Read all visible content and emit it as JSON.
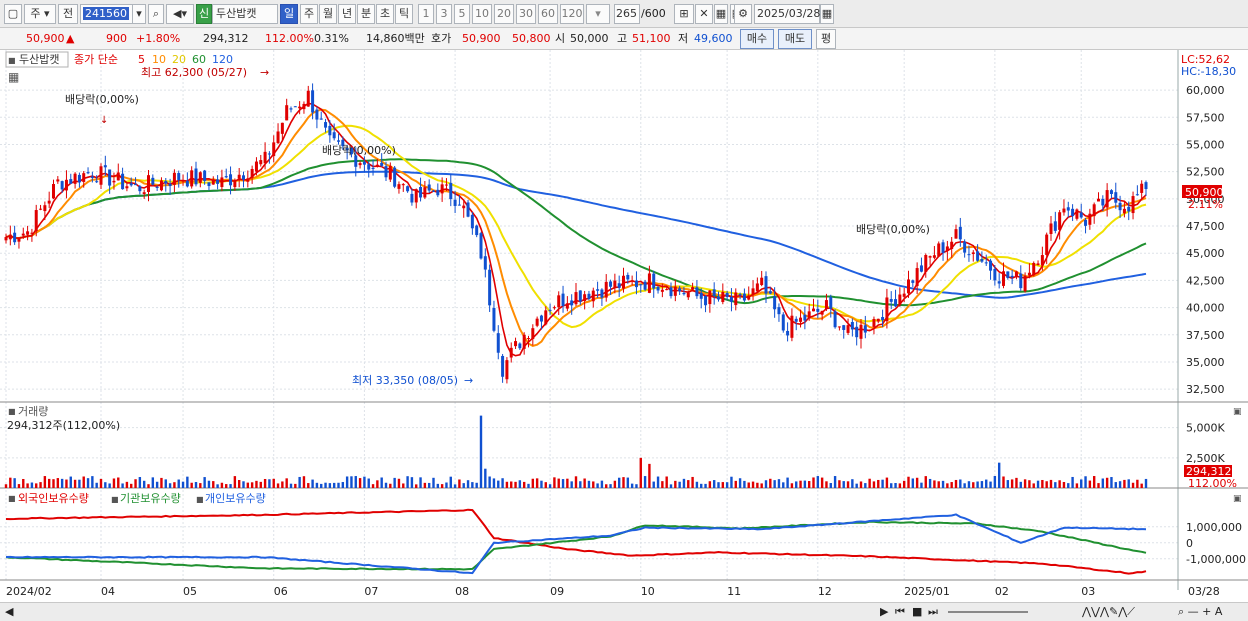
{
  "toolbar": {
    "market": "주",
    "type": "전",
    "code": "241560",
    "name": "두산밥캣",
    "period_sel": "일",
    "periods": [
      "주",
      "월",
      "년",
      "분",
      "초",
      "틱"
    ],
    "nums": [
      "1",
      "3",
      "5",
      "10",
      "20",
      "30",
      "60",
      "120"
    ],
    "count": "265",
    "count_total": "/600",
    "date": "2025/03/28"
  },
  "info": {
    "price": "50,900",
    "arrow": "▲",
    "change": "900",
    "pct": "+1.80%",
    "volume": "294,312",
    "vol_ratio": "112.00%",
    "turnover": "0.31%",
    "amount": "14,860백만",
    "hoga_label": "호가",
    "ask": "50,900",
    "bid": "50,800",
    "open_label": "시",
    "open": "50,000",
    "high_label": "고",
    "high": "51,100",
    "low_label": "저",
    "low": "49,600",
    "buy": "매수",
    "sell": "매도",
    "eval": "평"
  },
  "price_panel": {
    "title": "두산밥캣",
    "ma_label": "종가 단순",
    "ma_periods": [
      "5",
      "10",
      "20",
      "60",
      "120"
    ],
    "max_note": "최고 62,300 (05/27)",
    "min_note": "최저 33,350 (08/05)",
    "div_notes": [
      "배당락(0,00%)",
      "배당락(0,00%)",
      "배당락(0,00%)"
    ],
    "lc": "LC:52,62",
    "hc": "HC:-18,30",
    "cur_price": "50,900",
    "cur_pct": "2.11%",
    "yticks": [
      "60,000",
      "57,500",
      "55,000",
      "52,500",
      "50,000",
      "47,500",
      "45,000",
      "42,500",
      "40,000",
      "37,500",
      "35,000",
      "32,500"
    ]
  },
  "volume_panel": {
    "title": "거래량",
    "value": "294,312주(112,00%)",
    "yticks": [
      "5,000K",
      "2,500K"
    ],
    "cur": "294,312",
    "cur_pct": "112.00%"
  },
  "holding_panel": {
    "items": [
      "외국인보유수량",
      "기관보유수량",
      "개인보유수량"
    ],
    "yticks": [
      "1,000,000",
      "0",
      "-1,000,000"
    ]
  },
  "xaxis": {
    "labels": [
      "2024/02",
      "04",
      "05",
      "06",
      "07",
      "08",
      "09",
      "10",
      "11",
      "12",
      "2025/01",
      "02",
      "03"
    ],
    "end": "03/28"
  },
  "colors": {
    "up": "#e00000",
    "down": "#1050d0",
    "ma5": "#e00000",
    "ma10": "#ff8c00",
    "ma20": "#f0e000",
    "ma60": "#209030",
    "ma120": "#2060e0"
  },
  "chart_data": {
    "type": "candlestick",
    "days": 265,
    "anchors": [
      [
        0,
        46500
      ],
      [
        5,
        47000
      ],
      [
        12,
        51500
      ],
      [
        20,
        52500
      ],
      [
        30,
        51000
      ],
      [
        40,
        52000
      ],
      [
        50,
        51500
      ],
      [
        60,
        53500
      ],
      [
        65,
        58000
      ],
      [
        70,
        59500
      ],
      [
        75,
        55000
      ],
      [
        80,
        54000
      ],
      [
        90,
        52000
      ],
      [
        95,
        50000
      ],
      [
        100,
        51000
      ],
      [
        105,
        50000
      ],
      [
        110,
        45000
      ],
      [
        115,
        34500
      ],
      [
        120,
        37500
      ],
      [
        125,
        40000
      ],
      [
        130,
        41000
      ],
      [
        140,
        42000
      ],
      [
        150,
        42500
      ],
      [
        160,
        41000
      ],
      [
        170,
        40500
      ],
      [
        175,
        42000
      ],
      [
        180,
        38000
      ],
      [
        185,
        39000
      ],
      [
        190,
        40000
      ],
      [
        195,
        37500
      ],
      [
        200,
        38500
      ],
      [
        205,
        40500
      ],
      [
        215,
        45000
      ],
      [
        220,
        46500
      ],
      [
        230,
        43000
      ],
      [
        235,
        42500
      ],
      [
        240,
        45500
      ],
      [
        245,
        49500
      ],
      [
        250,
        48000
      ],
      [
        255,
        50000
      ],
      [
        260,
        49500
      ],
      [
        264,
        50900
      ]
    ],
    "price_range": [
      31500,
      63500
    ],
    "volume_max_k": 6300,
    "volume_spikes": {
      "110": 6000,
      "111": 1600,
      "147": 2500,
      "149": 2000,
      "230": 2100
    },
    "series_holding": [
      {
        "name": "외국인보유수량",
        "anchors": [
          [
            0,
            1500000
          ],
          [
            60,
            1750000
          ],
          [
            108,
            2050000
          ],
          [
            113,
            300000
          ],
          [
            130,
            -400000
          ],
          [
            145,
            -800000
          ],
          [
            165,
            -600000
          ],
          [
            200,
            -850000
          ],
          [
            240,
            -1300000
          ],
          [
            260,
            -1900000
          ],
          [
            264,
            -1800000
          ]
        ]
      },
      {
        "name": "기관보유수량",
        "anchors": [
          [
            0,
            -900000
          ],
          [
            60,
            -1600000
          ],
          [
            108,
            -1650000
          ],
          [
            113,
            -400000
          ],
          [
            140,
            400000
          ],
          [
            148,
            1100000
          ],
          [
            170,
            900000
          ],
          [
            200,
            1300000
          ],
          [
            225,
            1200000
          ],
          [
            240,
            700000
          ],
          [
            264,
            -650000
          ]
        ]
      },
      {
        "name": "개인보유수량",
        "anchors": [
          [
            0,
            -900000
          ],
          [
            60,
            -900000
          ],
          [
            108,
            -1900000
          ],
          [
            113,
            0
          ],
          [
            140,
            450000
          ],
          [
            148,
            950000
          ],
          [
            175,
            850000
          ],
          [
            220,
            1750000
          ],
          [
            235,
            0
          ],
          [
            245,
            950000
          ],
          [
            264,
            850000
          ]
        ]
      }
    ],
    "holding_range": [
      -2200000,
      2300000
    ]
  }
}
